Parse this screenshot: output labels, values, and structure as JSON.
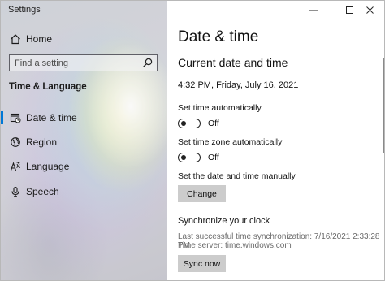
{
  "window": {
    "title": "Settings"
  },
  "sidebar": {
    "home_label": "Home",
    "search_placeholder": "Find a setting",
    "section_title": "Time & Language",
    "items": [
      {
        "label": "Date & time",
        "icon": "calendar-clock-icon",
        "selected": true
      },
      {
        "label": "Region",
        "icon": "globe-icon",
        "selected": false
      },
      {
        "label": "Language",
        "icon": "language-icon",
        "selected": false
      },
      {
        "label": "Speech",
        "icon": "microphone-icon",
        "selected": false
      }
    ]
  },
  "main": {
    "page_title": "Date & time",
    "subheading": "Current date and time",
    "current_datetime": "4:32 PM, Friday, July 16, 2021",
    "auto_time": {
      "label": "Set time automatically",
      "state": "Off"
    },
    "auto_timezone": {
      "label": "Set time zone automatically",
      "state": "Off"
    },
    "manual": {
      "label": "Set the date and time manually",
      "button": "Change"
    },
    "sync": {
      "heading": "Synchronize your clock",
      "last_sync": "Last successful time synchronization: 7/16/2021 2:33:28 PM",
      "server": "Time server: time.windows.com",
      "button": "Sync now"
    }
  },
  "colors": {
    "accent": "#0078d7",
    "button_bg": "#cccccc"
  }
}
